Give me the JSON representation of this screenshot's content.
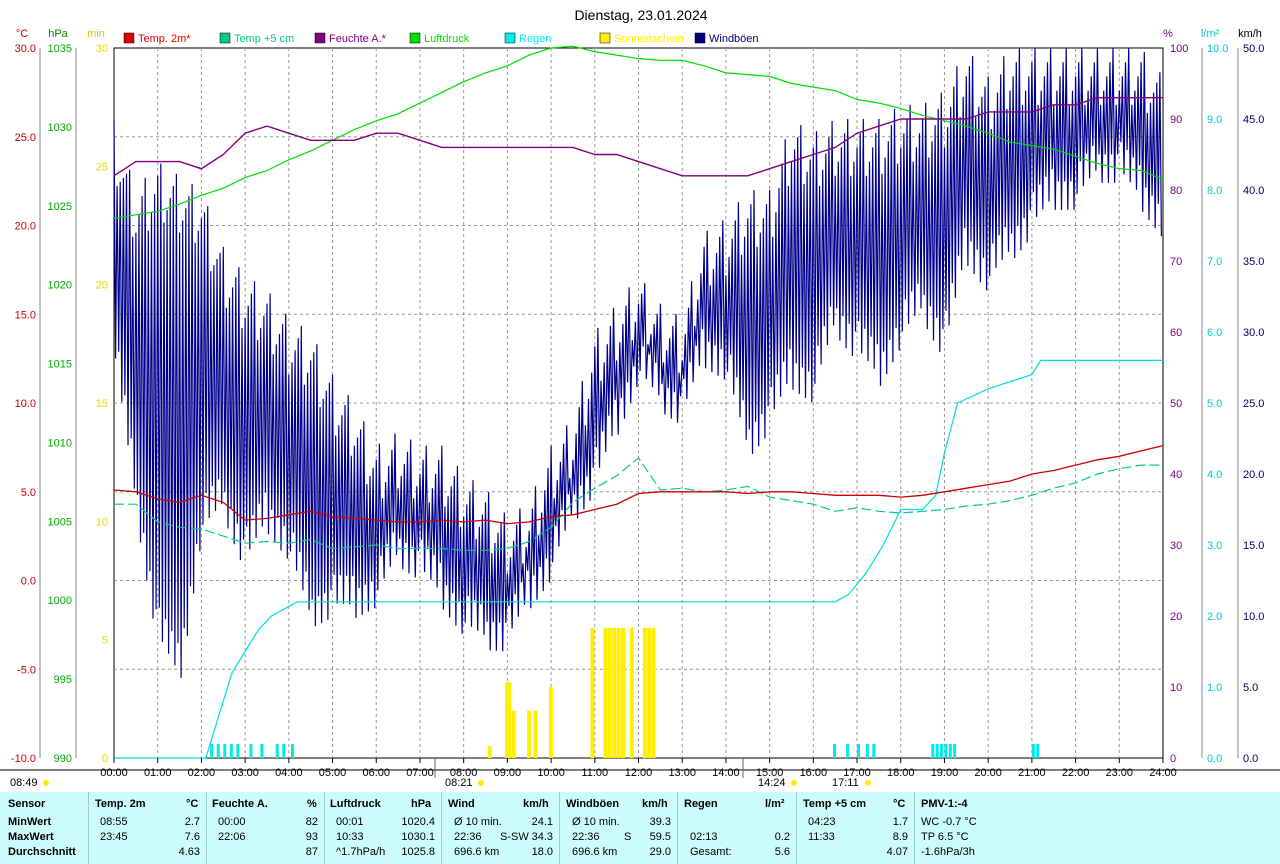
{
  "title": "Dienstag, 23.01.2024",
  "colors": {
    "temp2m": "#ff0000",
    "temp5cm": "#00cc88",
    "feuchte": "#800080",
    "luftdruck": "#00dd00",
    "regen": "#00eaea",
    "sonne": "#ffee00",
    "wind": "#00008b",
    "grid": "#888888"
  },
  "axis_units": {
    "temp": "°C",
    "hpa": "hPa",
    "min": "min",
    "pct": "%",
    "rain": "l/m²",
    "kmh": "km/h"
  },
  "legend": [
    {
      "label": "Temp. 2m*",
      "color": "#dd0000"
    },
    {
      "label": "Temp +5 cm",
      "color": "#00cc88"
    },
    {
      "label": "Feuchte A.*",
      "color": "#800080"
    },
    {
      "label": "Luftdruck",
      "color": "#00dd00"
    },
    {
      "label": "Regen",
      "color": "#00eeee"
    },
    {
      "label": "Sonnenschein",
      "color": "#ffee00"
    },
    {
      "label": "Windböen",
      "color": "#000080"
    }
  ],
  "sun_marks": [
    {
      "label": "08:49"
    },
    {
      "label": "08:21"
    },
    {
      "label": "14:24"
    },
    {
      "label": "17:11"
    }
  ],
  "chart_data": {
    "type": "line",
    "title": "Dienstag, 23.01.2024",
    "x_ticks": [
      "00:00",
      "01:00",
      "02:00",
      "03:00",
      "04:00",
      "05:00",
      "06:00",
      "07:00",
      "08:00",
      "09:00",
      "10:00",
      "11:00",
      "12:00",
      "13:00",
      "14:00",
      "15:00",
      "16:00",
      "17:00",
      "18:00",
      "19:00",
      "20:00",
      "21:00",
      "22:00",
      "23:00",
      "24:00"
    ],
    "x_range_hours": [
      0,
      24
    ],
    "axes": {
      "temp_c": {
        "range": [
          -10,
          30
        ],
        "ticks": [
          "-10.0",
          "-5.0",
          "0.0",
          "5.0",
          "10.0",
          "15.0",
          "20.0",
          "25.0",
          "30.0"
        ]
      },
      "hpa": {
        "range": [
          990,
          1030
        ],
        "ticks": [
          "990",
          "995",
          "1000",
          "1005",
          "1010",
          "1015",
          "1020",
          "1025",
          "1030",
          "1035"
        ]
      },
      "min": {
        "range": [
          0,
          30
        ],
        "ticks": [
          "0",
          "5",
          "10",
          "15",
          "20",
          "25",
          "30"
        ]
      },
      "pct": {
        "range": [
          0,
          100
        ],
        "ticks": [
          "0",
          "10",
          "20",
          "30",
          "40",
          "50",
          "60",
          "70",
          "80",
          "90",
          "100"
        ]
      },
      "rain": {
        "range": [
          0,
          10
        ],
        "ticks": [
          "0.0",
          "1.0",
          "2.0",
          "3.0",
          "4.0",
          "5.0",
          "6.0",
          "7.0",
          "8.0",
          "9.0",
          "10.0"
        ]
      },
      "kmh": {
        "range": [
          0,
          50
        ],
        "ticks": [
          "0.0",
          "5.0",
          "10.0",
          "15.0",
          "20.0",
          "25.0",
          "30.0",
          "35.0",
          "40.0",
          "45.0",
          "50.0"
        ]
      }
    },
    "grid": true,
    "series": [
      {
        "name": "Temp. 2m*",
        "axis": "temp_c",
        "x": [
          0,
          0.5,
          1,
          1.5,
          2,
          2.5,
          3,
          3.5,
          4,
          4.5,
          5,
          5.5,
          6,
          6.5,
          7,
          7.5,
          8,
          8.5,
          9,
          9.5,
          10,
          10.5,
          11,
          11.5,
          12,
          12.5,
          13,
          13.5,
          14,
          14.5,
          15,
          15.5,
          16,
          16.5,
          17,
          17.5,
          18,
          18.5,
          19,
          19.5,
          20,
          20.5,
          21,
          21.5,
          22,
          22.5,
          23,
          23.5,
          24
        ],
        "y": [
          5.1,
          5.0,
          4.6,
          4.4,
          4.8,
          4.4,
          3.4,
          3.5,
          3.7,
          3.9,
          3.6,
          3.5,
          3.4,
          3.3,
          3.3,
          3.4,
          3.3,
          3.4,
          3.2,
          3.3,
          3.6,
          3.7,
          4.0,
          4.3,
          4.9,
          5.0,
          5.0,
          5.0,
          5.0,
          4.9,
          5.0,
          5.0,
          4.9,
          4.8,
          4.8,
          4.8,
          4.7,
          4.8,
          5.0,
          5.2,
          5.4,
          5.6,
          6.0,
          6.2,
          6.5,
          6.8,
          7.0,
          7.3,
          7.6
        ]
      },
      {
        "name": "Temp +5 cm",
        "axis": "temp_c",
        "x": [
          0,
          0.5,
          1,
          1.5,
          2,
          2.5,
          3,
          3.5,
          4,
          4.5,
          5,
          5.5,
          6,
          6.5,
          7,
          7.5,
          8,
          8.5,
          9,
          9.5,
          10,
          10.5,
          11,
          11.5,
          12,
          12.5,
          13,
          13.5,
          14,
          14.5,
          15,
          15.5,
          16,
          16.5,
          17,
          17.5,
          18,
          18.5,
          19,
          19.5,
          20,
          20.5,
          21,
          21.5,
          22,
          22.5,
          23,
          23.5,
          24
        ],
        "y": [
          4.3,
          4.3,
          3.3,
          3.0,
          2.9,
          2.5,
          2.1,
          2.2,
          2.1,
          2.3,
          1.8,
          1.9,
          2.0,
          1.8,
          1.8,
          1.8,
          1.7,
          1.7,
          1.8,
          2.2,
          3.0,
          4.4,
          5.2,
          5.9,
          6.9,
          5.1,
          5.2,
          5.0,
          5.1,
          5.3,
          4.7,
          4.5,
          4.3,
          3.9,
          4.1,
          3.9,
          3.8,
          3.9,
          4.0,
          4.2,
          4.3,
          4.5,
          4.8,
          5.2,
          5.5,
          6.0,
          6.3,
          6.5,
          6.5
        ]
      },
      {
        "name": "Feuchte A.*",
        "axis": "pct",
        "x": [
          0,
          0.5,
          1,
          1.5,
          2,
          2.5,
          3,
          3.5,
          4,
          4.5,
          5,
          5.5,
          6,
          6.5,
          7,
          7.5,
          8,
          8.5,
          9,
          9.5,
          10,
          10.5,
          11,
          11.5,
          12,
          12.5,
          13,
          13.5,
          14,
          14.5,
          15,
          15.5,
          16,
          16.5,
          17,
          17.5,
          18,
          18.5,
          19,
          19.5,
          20,
          20.5,
          21,
          21.5,
          22,
          22.5,
          23,
          23.5,
          24
        ],
        "y": [
          82,
          84,
          84,
          84,
          83,
          85,
          88,
          89,
          88,
          87,
          87,
          87,
          88,
          88,
          87,
          86,
          86,
          86,
          86,
          86,
          86,
          86,
          85,
          85,
          84,
          83,
          82,
          82,
          82,
          82,
          83,
          84,
          85,
          86,
          88,
          89,
          90,
          90,
          90,
          90,
          91,
          91,
          91,
          92,
          92,
          93,
          93,
          93,
          93
        ]
      },
      {
        "name": "Luftdruck",
        "axis": "hpa",
        "x": [
          0,
          0.5,
          1,
          1.5,
          2,
          2.5,
          3,
          3.5,
          4,
          4.5,
          5,
          5.5,
          6,
          6.5,
          7,
          7.5,
          8,
          8.5,
          9,
          9.5,
          10,
          10.5,
          11,
          11.5,
          12,
          12.5,
          13,
          13.5,
          14,
          14.5,
          15,
          15.5,
          16,
          16.5,
          17,
          17.5,
          18,
          18.5,
          19,
          19.5,
          20,
          20.5,
          21,
          21.5,
          22,
          22.5,
          23,
          23.5,
          24
        ],
        "y": [
          1020.4,
          1020.6,
          1020.8,
          1021.2,
          1021.7,
          1022.1,
          1022.7,
          1023.1,
          1023.7,
          1024.2,
          1024.8,
          1025.4,
          1025.9,
          1026.3,
          1026.9,
          1027.5,
          1028.1,
          1028.6,
          1029.0,
          1029.6,
          1030.0,
          1030.1,
          1029.8,
          1029.6,
          1029.4,
          1029.3,
          1029.3,
          1029.0,
          1028.6,
          1028.5,
          1028.4,
          1028.0,
          1027.8,
          1027.6,
          1027.1,
          1026.9,
          1026.6,
          1026.2,
          1025.9,
          1025.6,
          1025.2,
          1024.7,
          1024.5,
          1024.3,
          1023.9,
          1023.5,
          1023.2,
          1023.1,
          1022.6
        ]
      },
      {
        "name": "Regen",
        "axis": "rain",
        "x": [
          0,
          2.1,
          2.3,
          2.5,
          2.7,
          3.0,
          3.3,
          3.6,
          3.9,
          4.2,
          16.5,
          16.8,
          17.2,
          17.6,
          18.0,
          18.5,
          18.8,
          19.0,
          19.3,
          20.0,
          21.0,
          21.2,
          22.0,
          24.0
        ],
        "y": [
          0,
          0,
          0.4,
          0.8,
          1.2,
          1.5,
          1.8,
          2.0,
          2.1,
          2.2,
          2.2,
          2.3,
          2.6,
          3.0,
          3.5,
          3.5,
          3.7,
          4.3,
          5.0,
          5.2,
          5.4,
          5.6,
          5.6,
          5.6
        ]
      },
      {
        "name": "Sonnenschein",
        "axis": "min",
        "type": "bar",
        "x": [
          8.55,
          8.95,
          9.0,
          9.1,
          9.45,
          9.6,
          9.95,
          10.0,
          10.5,
          10.9,
          11.2,
          11.3,
          11.4,
          11.5,
          11.6,
          11.8,
          12.1,
          12.2,
          12.3
        ],
        "y": [
          0.5,
          3.2,
          3.2,
          2.0,
          2.0,
          2.0,
          3.0,
          0,
          0,
          5.5,
          5.5,
          5.5,
          5.5,
          5.5,
          5.5,
          5.5,
          5.5,
          5.5,
          5.5
        ]
      },
      {
        "name": "Windböen",
        "axis": "kmh",
        "x": [
          0,
          0.5,
          1,
          1.5,
          2,
          2.5,
          3,
          3.5,
          4,
          4.5,
          5,
          5.5,
          6,
          6.5,
          7,
          7.5,
          8,
          8.5,
          9,
          9.5,
          10,
          10.5,
          11,
          11.5,
          12,
          12.5,
          13,
          13.5,
          14,
          14.5,
          15,
          15.5,
          16,
          16.5,
          17,
          17.5,
          18,
          18.5,
          19,
          19.5,
          20,
          20.5,
          21,
          21.5,
          22,
          22.5,
          23,
          23.5,
          24
        ],
        "y": [
          36,
          28,
          24,
          22,
          27,
          26,
          23,
          24,
          22,
          19,
          18,
          17,
          16,
          18,
          17,
          16,
          14,
          13,
          12,
          14,
          17,
          20,
          24,
          27,
          30,
          28,
          27,
          32,
          32,
          30,
          31,
          35,
          34,
          37,
          36,
          35,
          37,
          38,
          37,
          42,
          40,
          42,
          43,
          44,
          44,
          45,
          45,
          44,
          42
        ],
        "peaks": [
          45,
          40,
          42,
          41,
          40,
          36,
          34,
          33,
          31,
          30,
          27,
          25,
          22,
          23,
          22,
          22,
          20,
          19,
          17,
          18,
          22,
          24,
          30,
          32,
          34,
          32,
          31,
          37,
          38,
          40,
          40,
          45,
          44,
          45,
          45,
          45,
          46,
          46,
          47,
          50,
          48,
          50,
          50,
          50,
          50,
          50,
          50,
          50,
          48
        ]
      }
    ]
  },
  "summary": {
    "headers": {
      "sensor": "Sensor",
      "temp2m": "Temp. 2m",
      "temp2m_u": "°C",
      "feuchte": "Feuchte A.",
      "feuchte_u": "%",
      "druck": "Luftdruck",
      "druck_u": "hPa",
      "wind": "Wind",
      "wind_u": "km/h",
      "boeen": "Windböen",
      "boeen_u": "km/h",
      "regen": "Regen",
      "regen_u": "l/m²",
      "temp5": "Temp +5 cm",
      "temp5_u": "°C",
      "pmv": "PMV-1:-4"
    },
    "rows": [
      {
        "label": "MinWert",
        "t2_time": "08:55",
        "t2_val": "2.7",
        "f_time": "00:00",
        "f_val": "82",
        "d_time": "00:01",
        "d_val": "1020.4",
        "w_a": "Ø 10 min.",
        "w_b": "",
        "w_val": "24.1",
        "b_a": "Ø 10 min.",
        "b_b": "",
        "b_val": "39.3",
        "r_time": "",
        "r_val": "",
        "t5_time": "04:23",
        "t5_val": "1.7",
        "pmv": "WC -0.7 °C"
      },
      {
        "label": "MaxWert",
        "t2_time": "23:45",
        "t2_val": "7.6",
        "f_time": "22:06",
        "f_val": "93",
        "d_time": "10:33",
        "d_val": "1030.1",
        "w_a": "22:36",
        "w_b": "S-SW",
        "w_val": "34.3",
        "b_a": "22:36",
        "b_b": "S",
        "b_val": "59.5",
        "r_time": "02:13",
        "r_val": "0.2",
        "t5_time": "11:33",
        "t5_val": "8.9",
        "pmv": "TP 6.5 °C"
      },
      {
        "label": "Durchschnitt",
        "t2_time": "",
        "t2_val": "4.63",
        "f_time": "",
        "f_val": "87",
        "d_time": "^1.7hPa/h",
        "d_val": "1025.8",
        "w_a": "696.6 km",
        "w_b": "",
        "w_val": "18.0",
        "b_a": "696.6 km",
        "b_b": "",
        "b_val": "29.0",
        "r_time": "Gesamt:",
        "r_val": "5.6",
        "t5_time": "",
        "t5_val": "4.07",
        "pmv": "-1.6hPa/3h"
      }
    ]
  }
}
